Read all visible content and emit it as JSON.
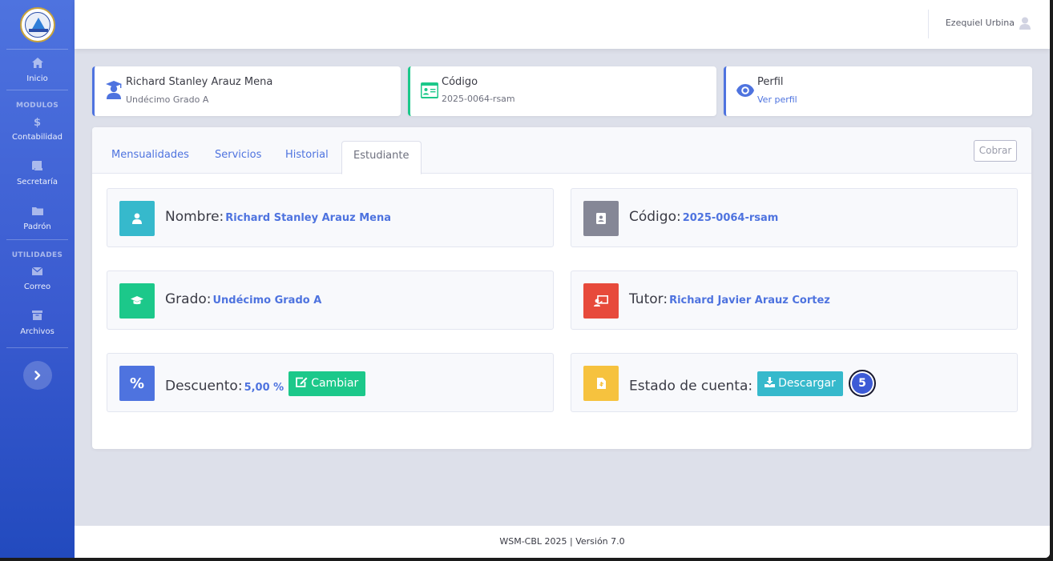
{
  "sidebar": {
    "items": [
      {
        "label": "Inicio",
        "icon": "home-icon"
      },
      {
        "label": "Contabilidad",
        "icon": "dollar-icon"
      },
      {
        "label": "Secretaría",
        "icon": "scroll-icon"
      },
      {
        "label": "Padrón",
        "icon": "folder-icon"
      },
      {
        "label": "Correo",
        "icon": "envelope-icon"
      },
      {
        "label": "Archivos",
        "icon": "archive-icon"
      }
    ],
    "headings": {
      "modulos": "MODULOS",
      "utilidades": "UTILIDADES"
    }
  },
  "topbar": {
    "user_name": "Ezequiel Urbina"
  },
  "info_cards": {
    "student": {
      "name": "Richard Stanley Arauz Mena",
      "grade": "Undécimo Grado A"
    },
    "code": {
      "title": "Código",
      "value": "2025-0064-rsam"
    },
    "profile": {
      "title": "Perfil",
      "link": "Ver perfil"
    }
  },
  "tabs": [
    {
      "label": "Mensualidades",
      "active": false
    },
    {
      "label": "Servicios",
      "active": false
    },
    {
      "label": "Historial",
      "active": false
    },
    {
      "label": "Estudiante",
      "active": true
    }
  ],
  "cobrar_label": "Cobrar",
  "fields": {
    "nombre": {
      "label": "Nombre:",
      "value": "Richard Stanley Arauz Mena"
    },
    "codigo": {
      "label": "Código:",
      "value": "2025-0064-rsam"
    },
    "grado": {
      "label": "Grado:",
      "value": "Undécimo Grado A"
    },
    "tutor": {
      "label": "Tutor:",
      "value": "Richard Javier Arauz Cortez"
    },
    "descuento": {
      "label": "Descuento:",
      "value": "5,00 %",
      "button": "Cambiar",
      "icon_text": "%"
    },
    "estado": {
      "label": "Estado de cuenta:",
      "button": "Descargar",
      "badge": "5"
    }
  },
  "colors": {
    "primary": "#4e73df",
    "info": "#36b9cc",
    "secondary": "#858796",
    "success": "#1cc88a",
    "danger": "#e74a3b",
    "warning": "#f6c23e"
  },
  "footer": {
    "text": "WSM-CBL 2025 | Versión 7.0"
  }
}
